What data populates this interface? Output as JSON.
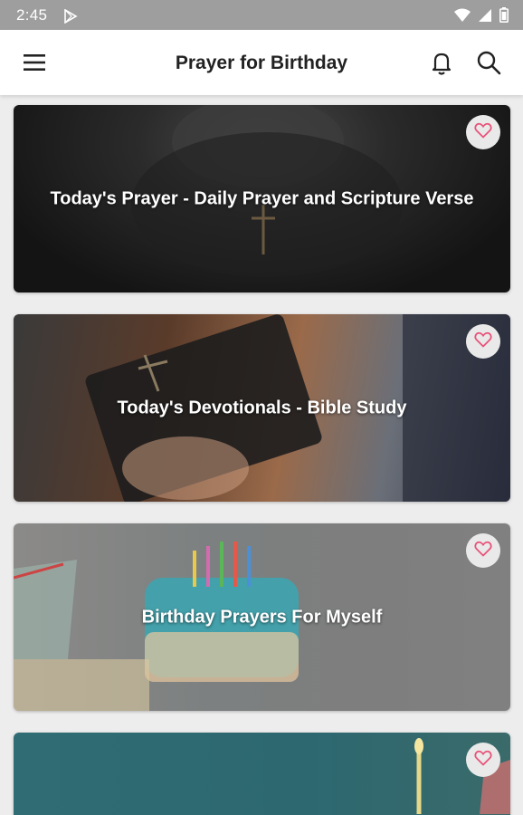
{
  "status_bar": {
    "time": "2:45"
  },
  "app_bar": {
    "title": "Prayer for Birthday"
  },
  "cards": [
    {
      "label": "Today's Prayer - Daily Prayer and Scripture Verse"
    },
    {
      "label": "Today's Devotionals - Bible Study"
    },
    {
      "label": "Birthday Prayers For Myself"
    },
    {
      "label": ""
    }
  ],
  "colors": {
    "heart": "#e8537a",
    "app_bar_bg": "#ffffff",
    "status_bar_bg": "#9e9e9e"
  },
  "icons": [
    "menu-icon",
    "bell-icon",
    "search-icon",
    "heart-icon",
    "wifi-icon",
    "signal-icon",
    "battery-icon",
    "play-store-icon"
  ]
}
